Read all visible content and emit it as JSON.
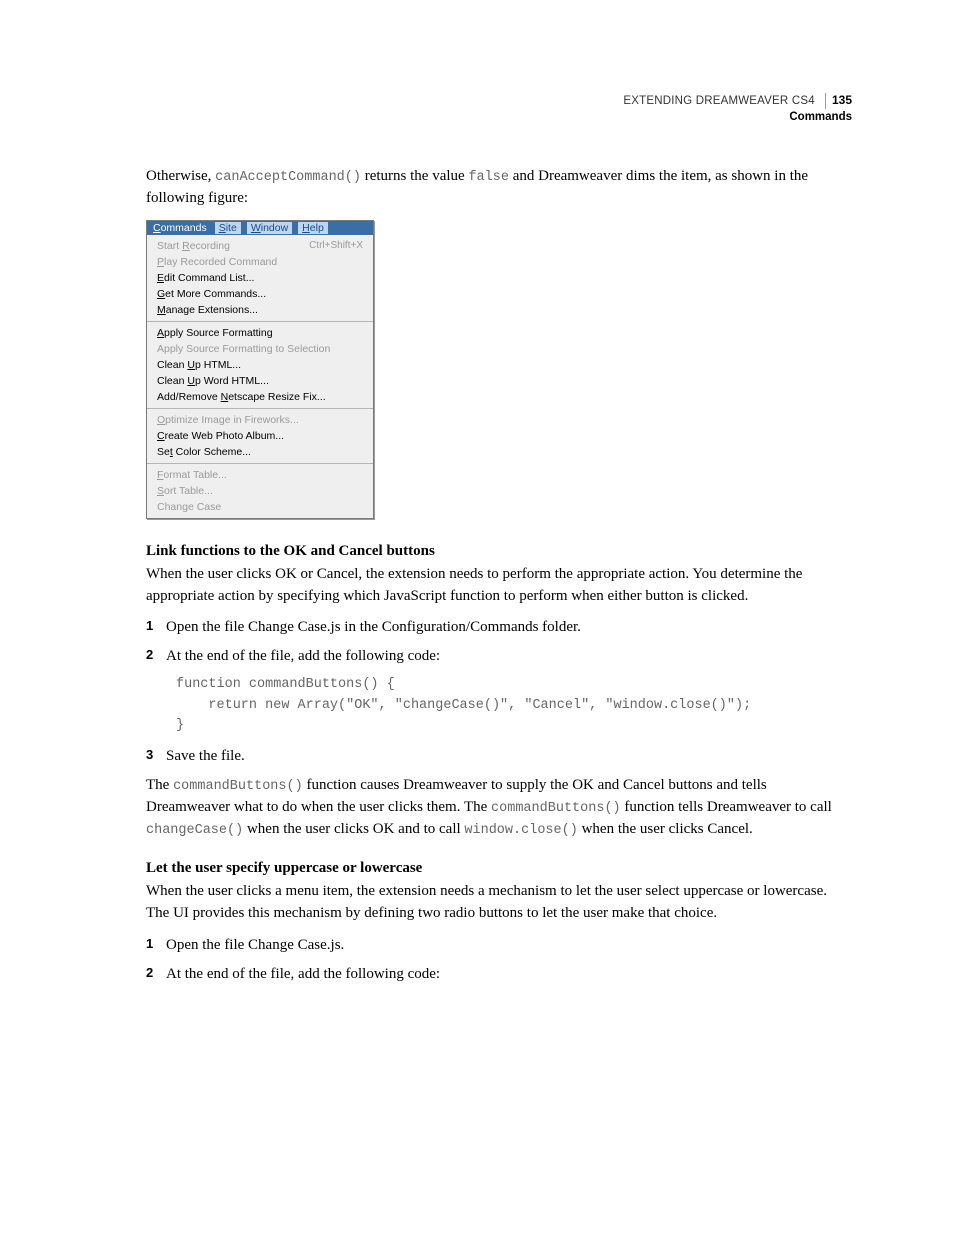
{
  "header": {
    "title": "EXTENDING DREAMWEAVER CS4",
    "section": "Commands",
    "page_number": "135"
  },
  "intro": {
    "pre": "Otherwise, ",
    "code1": "canAcceptCommand()",
    "mid": " returns the value ",
    "code2": "false",
    "post": " and Dreamweaver dims the item, as shown in the following figure:"
  },
  "menu": {
    "bar": {
      "commands": "Commands",
      "site": "Site",
      "window": "Window",
      "help": "Help"
    },
    "groups": [
      {
        "items": [
          {
            "label": "Start Recording",
            "disabled": true,
            "u": 6,
            "shortcut": "Ctrl+Shift+X"
          },
          {
            "label": "Play Recorded Command",
            "disabled": true,
            "u": 0
          },
          {
            "label": "Edit Command List...",
            "disabled": false,
            "u": 0
          },
          {
            "label": "Get More Commands...",
            "disabled": false,
            "u": 0
          },
          {
            "label": "Manage Extensions...",
            "disabled": false,
            "u": 0
          }
        ]
      },
      {
        "items": [
          {
            "label": "Apply Source Formatting",
            "disabled": false,
            "u": 0
          },
          {
            "label": "Apply Source Formatting to Selection",
            "disabled": true,
            "u": -1
          },
          {
            "label": "Clean Up HTML...",
            "disabled": false,
            "u": 6
          },
          {
            "label": "Clean Up Word HTML...",
            "disabled": false,
            "u": 6
          },
          {
            "label": "Add/Remove Netscape Resize Fix...",
            "disabled": false,
            "u": 11
          }
        ]
      },
      {
        "items": [
          {
            "label": "Optimize Image in Fireworks...",
            "disabled": true,
            "u": 0
          },
          {
            "label": "Create Web Photo Album...",
            "disabled": false,
            "u": 0
          },
          {
            "label": "Set Color Scheme...",
            "disabled": false,
            "u": 2
          }
        ]
      },
      {
        "items": [
          {
            "label": "Format Table...",
            "disabled": true,
            "u": 0
          },
          {
            "label": "Sort Table...",
            "disabled": true,
            "u": 0
          },
          {
            "label": "Change Case",
            "disabled": true,
            "u": -1
          }
        ]
      }
    ]
  },
  "section1": {
    "heading": "Link functions to the OK and Cancel buttons",
    "para": "When the user clicks OK or Cancel, the extension needs to perform the appropriate action. You determine the appropriate action by specifying which JavaScript function to perform when either button is clicked.",
    "steps": [
      "Open the file Change Case.js in the Configuration/Commands folder.",
      "At the end of the file, add the following code:"
    ],
    "code": "function commandButtons() {\n    return new Array(\"OK\", \"changeCase()\", \"Cancel\", \"window.close()\");\n}",
    "step3": "Save the file."
  },
  "para2": {
    "p1": "The ",
    "c1": "commandButtons()",
    "p2": " function causes Dreamweaver to supply the OK and Cancel buttons and tells Dreamweaver what to do when the user clicks them. The ",
    "c2": "commandButtons()",
    "p3": " function tells Dreamweaver to call ",
    "c3": "changeCase()",
    "p4": " when the user clicks OK and to call ",
    "c4": "window.close()",
    "p5": " when the user clicks Cancel."
  },
  "section2": {
    "heading": "Let the user specify uppercase or lowercase",
    "para": "When the user clicks a menu item, the extension needs a mechanism to let the user select uppercase or lowercase. The UI provides this mechanism by defining two radio buttons to let the user make that choice.",
    "steps": [
      "Open the file Change Case.js.",
      "At the end of the file, add the following code:"
    ]
  }
}
